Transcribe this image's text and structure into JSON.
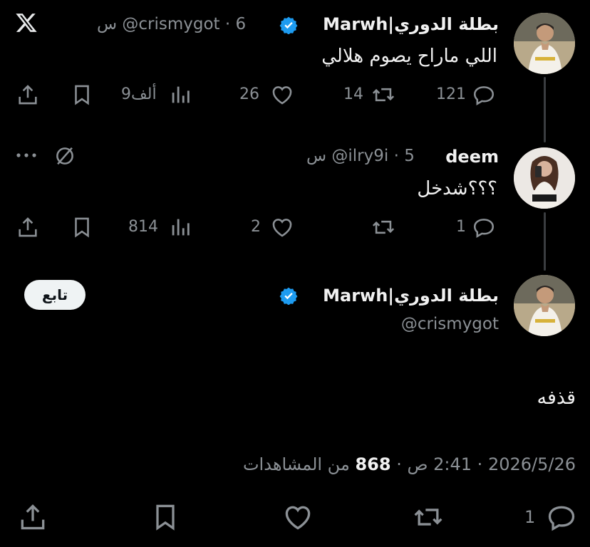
{
  "tweet1": {
    "author_name": "بطلة الدوري|Marwh",
    "handle": "@crismygot",
    "time": "6 س",
    "text": "اللي ماراح يصوم هلالي",
    "replies": "121",
    "retweets": "14",
    "likes": "26",
    "views": "9ألف"
  },
  "tweet2": {
    "author_name": "deem",
    "handle": "@ilry9i",
    "time": "5 س",
    "text": "؟؟؟شدخل",
    "replies": "1",
    "retweets": "",
    "likes": "2",
    "views": "814"
  },
  "main_tweet": {
    "author_name": "بطلة الدوري|Marwh",
    "handle": "@crismygot",
    "follow_label": "تابع",
    "text": "قذفه",
    "date": "2026/5/26",
    "time": "2:41 ص",
    "views_count": "868",
    "views_label": "من المشاهدات",
    "replies": "1"
  },
  "colors": {
    "background": "#000000",
    "verified": "#1d9bf0",
    "muted": "#8b9095",
    "thread_line": "#3a3d40"
  },
  "icons": [
    "x-logo-icon",
    "verified-badge-icon",
    "reply-icon",
    "retweet-icon",
    "like-icon",
    "views-icon",
    "bookmark-icon",
    "share-icon",
    "more-icon",
    "grok-icon"
  ]
}
